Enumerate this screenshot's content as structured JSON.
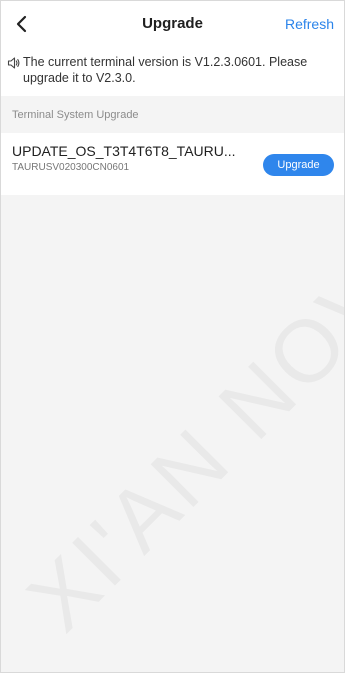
{
  "header": {
    "title": "Upgrade",
    "refresh_label": "Refresh",
    "back_icon": "chevron-left-icon"
  },
  "notice": {
    "icon": "speaker-icon",
    "text": "The current terminal version is V1.2.3.0601. Please upgrade it to V2.3.0."
  },
  "section": {
    "title": "Terminal System Upgrade"
  },
  "packages": [
    {
      "name": "UPDATE_OS_T3T4T6T8_TAURU...",
      "code": "TAURUSV020300CN0601",
      "action_label": "Upgrade"
    }
  ],
  "watermark": "XI'AN NOV",
  "colors": {
    "accent": "#2f86ec",
    "background": "#f4f4f4",
    "card": "#ffffff"
  }
}
